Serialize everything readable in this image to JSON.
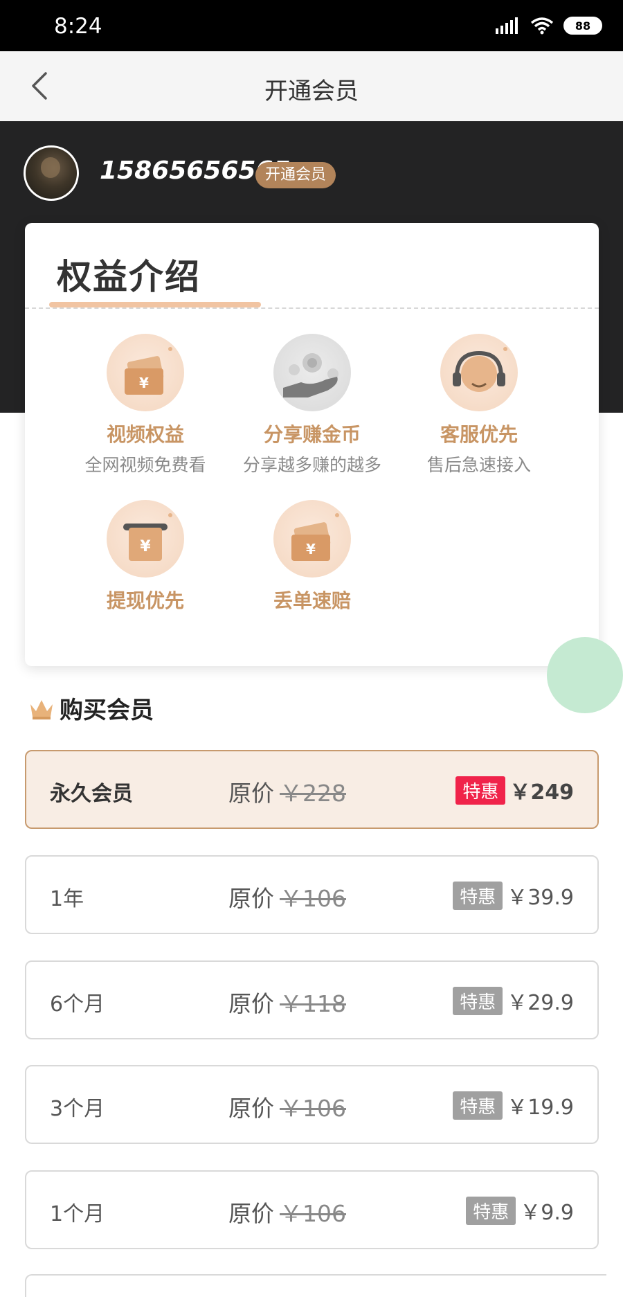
{
  "status": {
    "time": "8:24",
    "battery": "88"
  },
  "nav": {
    "title": "开通会员"
  },
  "user": {
    "phone": "15865656565",
    "badge": "开通会员"
  },
  "benefits": {
    "title": "权益介绍",
    "items": [
      {
        "name": "视频权益",
        "desc": "全网视频免费看",
        "icon": "ticket-icon"
      },
      {
        "name": "分享赚金币",
        "desc": "分享越多赚的越多",
        "icon": "coins-hand-icon"
      },
      {
        "name": "客服优先",
        "desc": "售后急速接入",
        "icon": "headset-icon"
      },
      {
        "name": "提现优先",
        "desc": "",
        "icon": "withdraw-icon"
      },
      {
        "name": "丢单速赔",
        "desc": "",
        "icon": "ticket-icon"
      }
    ]
  },
  "purchase": {
    "title": "购买会员",
    "orig_label": "原价",
    "tag": "特惠",
    "plans": [
      {
        "name": "永久会员",
        "orig": "￥228",
        "price": "￥249",
        "selected": true
      },
      {
        "name": "1年",
        "orig": "￥106",
        "price": "￥39.9",
        "selected": false
      },
      {
        "name": "6个月",
        "orig": "￥118",
        "price": "￥29.9",
        "selected": false
      },
      {
        "name": "3个月",
        "orig": "￥106",
        "price": "￥19.9",
        "selected": false
      },
      {
        "name": "1个月",
        "orig": "￥106",
        "price": "￥9.9",
        "selected": false
      }
    ]
  },
  "colors": {
    "accent": "#c89564",
    "badge": "#b2845a",
    "tag_selected": "#f0234a",
    "header_bg": "#232324"
  }
}
